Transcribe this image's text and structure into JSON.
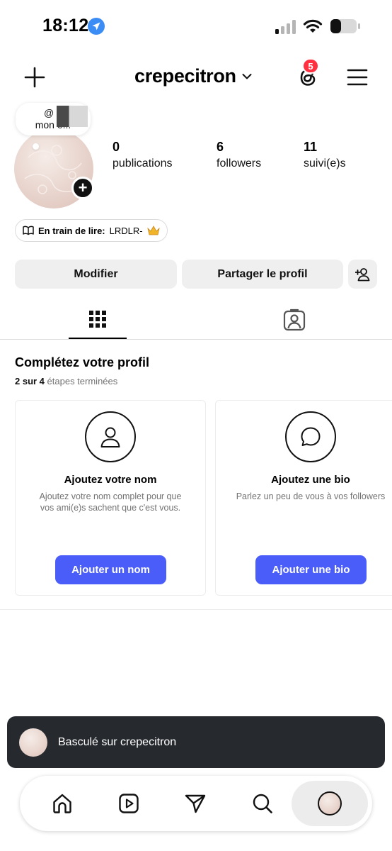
{
  "status_bar": {
    "time": "18:12",
    "icons": [
      "location-arrow-icon",
      "cellular-signal-icon",
      "wifi-icon",
      "battery-icon"
    ]
  },
  "header": {
    "username": "crepecitron",
    "threads_badge_count": "5",
    "icons": [
      "plus-icon",
      "chevron-down-icon",
      "threads-icon",
      "menu-icon"
    ]
  },
  "note": {
    "line1": "@ n",
    "line2": "mon      e..."
  },
  "stats": [
    {
      "value": "0",
      "label": "publications"
    },
    {
      "value": "6",
      "label": "followers"
    },
    {
      "value": "11",
      "label": "suivi(e)s"
    }
  ],
  "reading": {
    "label": "En train de lire:",
    "value": "LRDLR-"
  },
  "buttons": {
    "edit": "Modifier",
    "share": "Partager le profil"
  },
  "complete_profile": {
    "title": "Complétez votre profil",
    "progress_bold": "2 sur 4",
    "progress_text": " étapes terminées",
    "cards": [
      {
        "title": "Ajoutez votre nom",
        "text": "Ajoutez votre nom complet pour que\nvos ami(e)s sachent que c'est vous.",
        "button": "Ajouter un nom",
        "icon": "person-icon"
      },
      {
        "title": "Ajoutez une bio",
        "text": "Parlez un peu de vous à vos followers",
        "button": "Ajouter une bio",
        "icon": "speech-bubble-icon"
      }
    ]
  },
  "toast": {
    "text": "Basculé sur crepecitron"
  },
  "bottom_nav": {
    "items": [
      "home-icon",
      "reels-icon",
      "direct-icon",
      "search-icon",
      "profile-avatar"
    ]
  },
  "colors": {
    "primary_button": "#4a5df9",
    "badge": "#ff3040",
    "toast_bg": "#262a2f",
    "gray_button": "#efefef"
  }
}
